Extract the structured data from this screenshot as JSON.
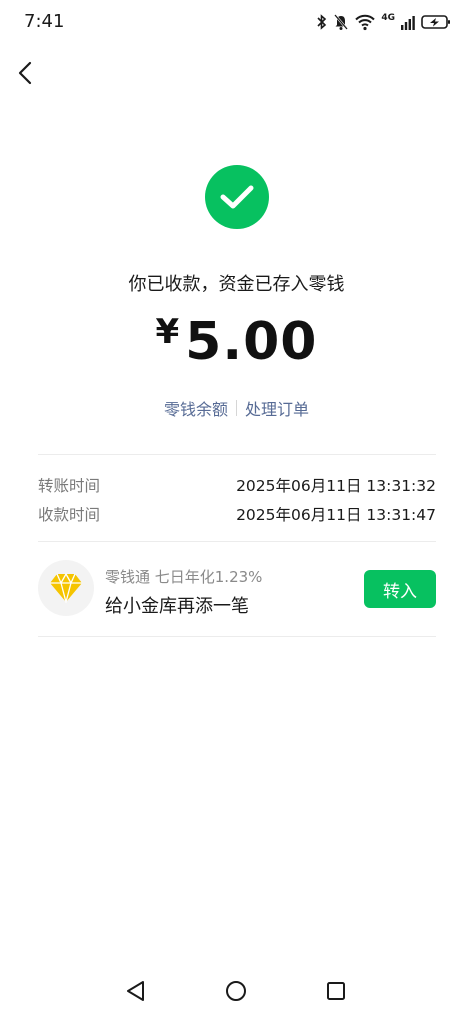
{
  "status_bar": {
    "time": "7:41",
    "network_label": "4G",
    "icons": [
      "bluetooth-icon",
      "mute-icon",
      "wifi-icon",
      "signal-icon",
      "battery-charging-icon"
    ]
  },
  "back_icon": "chevron-left-icon",
  "success": {
    "icon": "check-circle-icon",
    "message": "你已收款，资金已存入零钱",
    "currency": "¥",
    "amount": "5.00"
  },
  "links": {
    "balance": "零钱余额",
    "order": "处理订单"
  },
  "details": [
    {
      "label": "转账时间",
      "value": "2025年06月11日 13:31:32"
    },
    {
      "label": "收款时间",
      "value": "2025年06月11日 13:31:47"
    }
  ],
  "promo": {
    "icon": "diamond-icon",
    "subtitle": "零钱通 七日年化1.23%",
    "title": "给小金库再添一笔",
    "button": "转入"
  },
  "colors": {
    "accent": "#07c160",
    "link": "#576b95",
    "diamond": "#f5c400"
  },
  "nav": [
    "back-triangle-icon",
    "home-circle-icon",
    "recents-square-icon"
  ]
}
